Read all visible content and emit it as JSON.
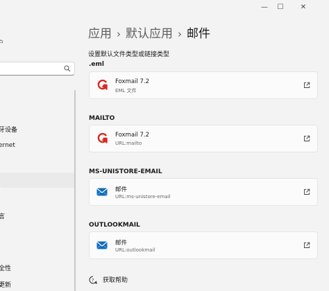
{
  "sidebar": {
    "user_fragment": "户",
    "search": {
      "placeholder": ""
    },
    "items": [
      {
        "label": "牙设备"
      },
      {
        "label": "ernet"
      },
      {
        "label": "言"
      },
      {
        "label": "全性"
      },
      {
        "label": "更新"
      }
    ]
  },
  "window": {
    "minimize": "—",
    "maximize": "☐",
    "close": "✕"
  },
  "breadcrumb": {
    "part1": "应用",
    "part2": "默认应用",
    "current": "邮件",
    "separator": "›"
  },
  "subtitle": "设置默认文件类型或链接类型",
  "sections": [
    {
      "label": ".eml",
      "app_name": "Foxmail 7.2",
      "app_detail": "EML 文件",
      "icon": "foxmail-icon"
    },
    {
      "label": "MAILTO",
      "app_name": "Foxmail 7.2",
      "app_detail": "URL:mailto",
      "icon": "foxmail-icon"
    },
    {
      "label": "MS-UNISTORE-EMAIL",
      "app_name": "邮件",
      "app_detail": "URL:ms-unistore-email",
      "icon": "mail-app-icon"
    },
    {
      "label": "OUTLOOKMAIL",
      "app_name": "邮件",
      "app_detail": "URL:outlookmail",
      "icon": "mail-app-icon"
    }
  ],
  "help": {
    "label": "获取帮助",
    "icon": "help-icon"
  },
  "colors": {
    "foxmail_red": "#d9281e",
    "mail_blue": "#0f6cbd",
    "background": "#f3f3f3",
    "card": "#fbfbfb"
  }
}
